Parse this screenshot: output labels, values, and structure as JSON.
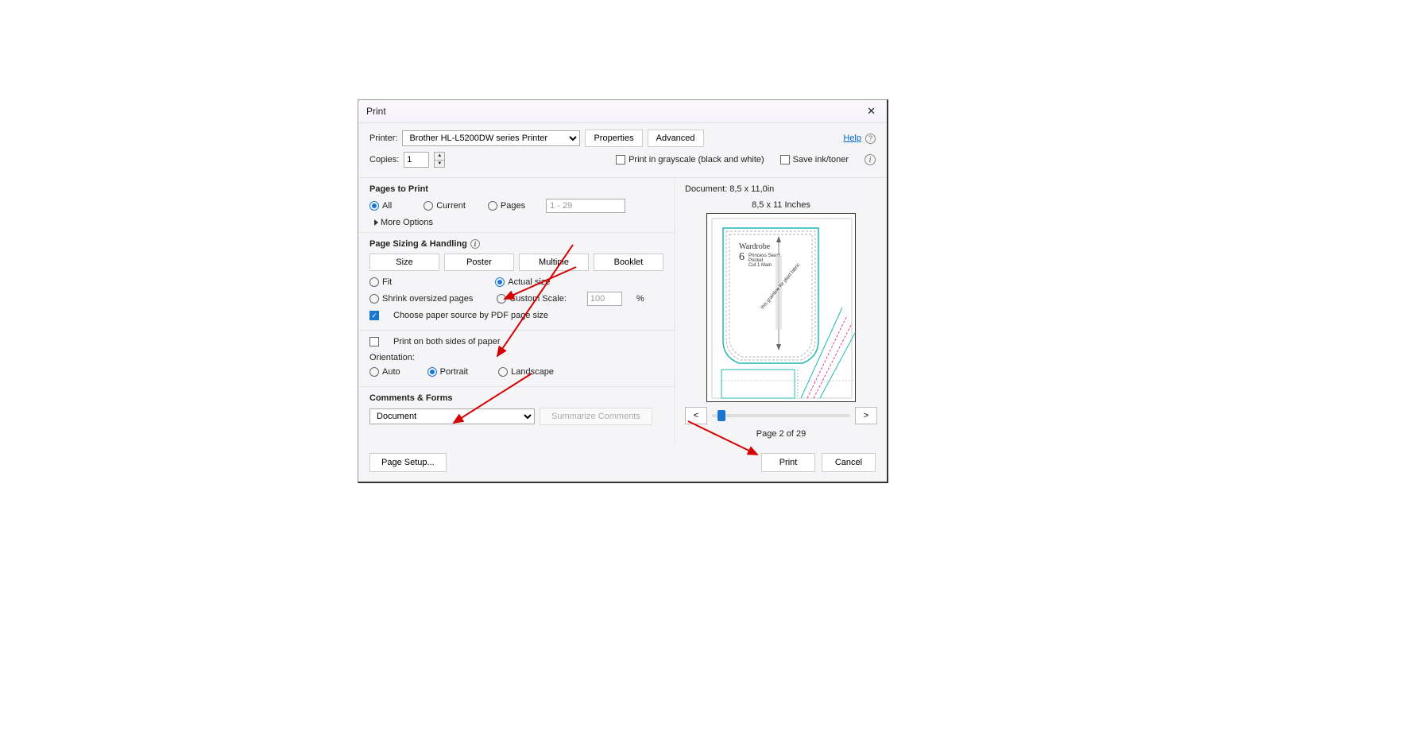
{
  "title": "Print",
  "help_label": "Help",
  "printer": {
    "label": "Printer:",
    "value": "Brother HL-L5200DW series Printer",
    "properties_btn": "Properties",
    "advanced_btn": "Advanced"
  },
  "copies": {
    "label": "Copies:",
    "value": "1"
  },
  "grayscale_label": "Print in grayscale (black and white)",
  "save_ink_label": "Save ink/toner",
  "pages_to_print": {
    "title": "Pages to Print",
    "all": "All",
    "current": "Current",
    "pages": "Pages",
    "pages_value": "1 - 29",
    "more_options": "More Options"
  },
  "page_sizing": {
    "title": "Page Sizing & Handling",
    "size": "Size",
    "poster": "Poster",
    "multiple": "Multiple",
    "booklet": "Booklet",
    "fit": "Fit",
    "actual_size": "Actual size",
    "shrink": "Shrink oversized pages",
    "custom_scale": "Custom Scale:",
    "custom_scale_value": "100",
    "percent": "%",
    "choose_paper": "Choose paper source by PDF page size"
  },
  "both_sides": "Print on both sides of paper",
  "orientation": {
    "title": "Orientation:",
    "auto": "Auto",
    "portrait": "Portrait",
    "landscape": "Landscape"
  },
  "comments_forms": {
    "title": "Comments & Forms",
    "value": "Document",
    "summarize": "Summarize Comments"
  },
  "preview": {
    "doc_label": "Document: 8,5 x 11,0in",
    "size_label": "8,5 x 11 Inches",
    "page_counter": "Page 2 of 29"
  },
  "footer": {
    "page_setup": "Page Setup...",
    "print": "Print",
    "cancel": "Cancel"
  }
}
